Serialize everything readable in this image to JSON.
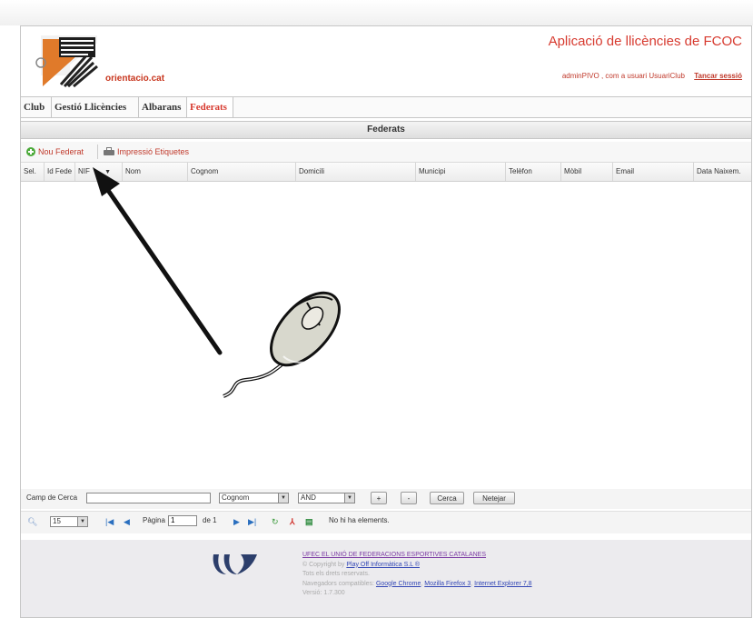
{
  "header": {
    "app_title": "Aplicació de llicències de FCOC",
    "site_name": "orientacio.cat",
    "user_text": "adminPIVO , com a usuari  UsuariClub",
    "logout": "Tancar sessió"
  },
  "menu": {
    "items": [
      {
        "label": "Club"
      },
      {
        "label": "Gestió Llicències"
      },
      {
        "label": "Albarans"
      },
      {
        "label": "Federats"
      }
    ],
    "active": "Federats"
  },
  "panel": {
    "title": "Federats",
    "toolbar": {
      "new": "Nou Federat",
      "print": "Impressió Etiquetes"
    },
    "columns": [
      "Sel.",
      "Id Fede",
      "NIF",
      "Nom",
      "Cognom",
      "Domicili",
      "Municipi",
      "Telèfon",
      "Mòbil",
      "Email",
      "Data Naixem."
    ]
  },
  "search": {
    "label": "Camp de Cerca",
    "value": "",
    "field": "Cognom",
    "operator": "AND",
    "add": "+",
    "remove": "-",
    "search": "Cerca",
    "clear": "Netejar"
  },
  "pager": {
    "page_size": "15",
    "page_label": "Pàgina",
    "page": "1",
    "of": "de 1",
    "status": "No hi ha elements."
  },
  "footer": {
    "org": "UFEC EL UNIÓ DE FEDERACIONS ESPORTIVES CATALANES",
    "copyright_prefix": "© Copyright by",
    "copyright_link": "Play Off Informàtica S.L ®",
    "rights": "Tots els drets reservats.",
    "browsers_prefix": "Navegadors compatibles:",
    "chrome": "Google Chrome",
    "firefox": "Mozilla Firefox 3",
    "ie": "Internet Explorer 7,8",
    "version": "Versió: 1.7.300"
  },
  "colors": {
    "accent": "#d73a2f",
    "footer_bg": "#ecebee",
    "link": "#3347b5"
  }
}
